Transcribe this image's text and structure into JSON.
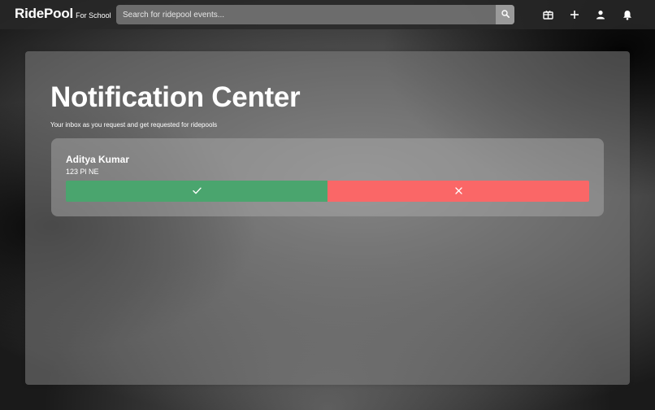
{
  "header": {
    "brand_name": "RidePool",
    "brand_sub": "For School",
    "search_placeholder": "Search for ridepool events...",
    "icons": [
      "search-icon",
      "gift-icon",
      "plus-icon",
      "person-icon",
      "bell-icon"
    ]
  },
  "main": {
    "title": "Notification Center",
    "subtitle": "Your inbox as you request and get requested for ridepools",
    "notifications": [
      {
        "name": "Aditya Kumar",
        "address": "123 Pl NE",
        "accept_icon": "check-icon",
        "decline_icon": "close-icon"
      }
    ]
  },
  "colors": {
    "accept": "#4aa56e",
    "decline": "#fa6767",
    "text": "#ffffff"
  }
}
